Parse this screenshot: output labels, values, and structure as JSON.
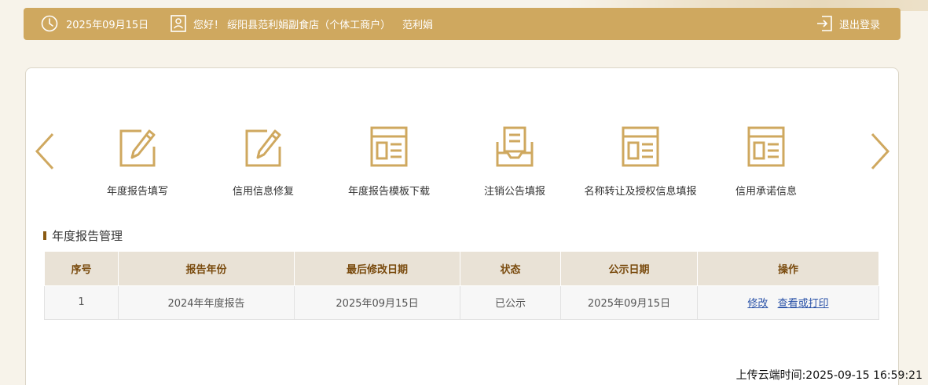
{
  "header": {
    "date": "2025年09月15日",
    "greeting": "您好！  绥阳县范利娟副食店（个体工商户）",
    "username": "范利娟",
    "logout_label": "退出登录"
  },
  "menu": {
    "items": [
      {
        "label": "年度报告填写",
        "icon": "edit-icon"
      },
      {
        "label": "信用信息修复",
        "icon": "edit-icon"
      },
      {
        "label": "年度报告模板下载",
        "icon": "document-icon"
      },
      {
        "label": "注销公告填报",
        "icon": "inbox-icon"
      },
      {
        "label": "名称转让及授权信息填报",
        "icon": "document-icon"
      },
      {
        "label": "信用承诺信息",
        "icon": "document-icon"
      }
    ]
  },
  "section": {
    "title": "年度报告管理"
  },
  "table": {
    "headers": [
      "序号",
      "报告年份",
      "最后修改日期",
      "状态",
      "公示日期",
      "操作"
    ],
    "rows": [
      {
        "index": "1",
        "year": "2024年年度报告",
        "modified": "2025年09月15日",
        "status": "已公示",
        "publish_date": "2025年09月15日",
        "actions": [
          "修改",
          "查看或打印"
        ]
      }
    ]
  },
  "footer": {
    "upload_time": "上传云端时间:2025-09-15 16:59:21"
  },
  "colors": {
    "accent": "#cfa85f",
    "header_text": "#7a4b0e",
    "link": "#2b53a8"
  }
}
